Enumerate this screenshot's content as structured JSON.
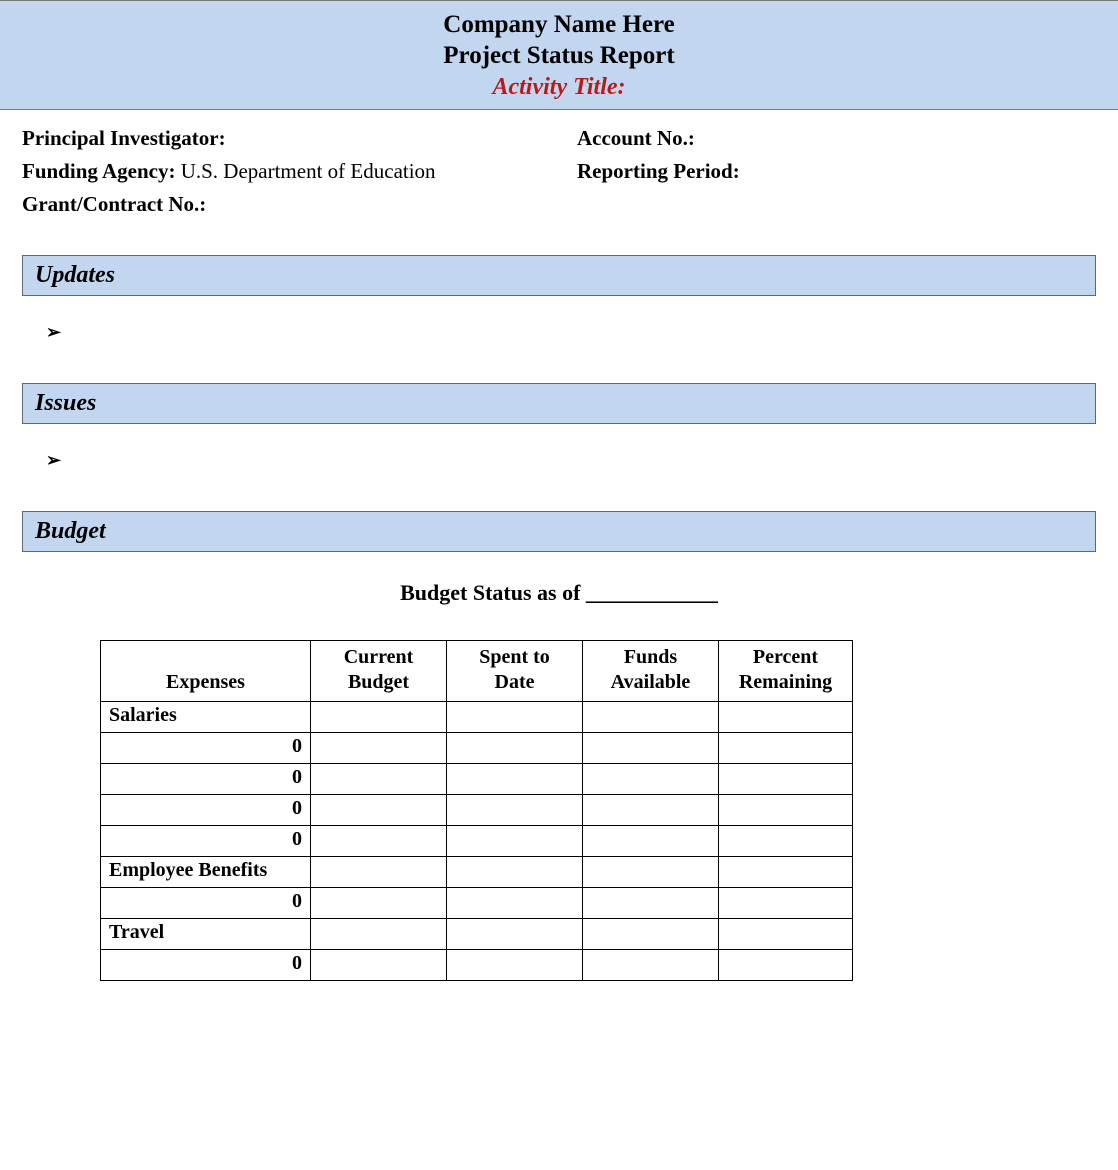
{
  "header": {
    "company": "Company Name Here",
    "report_title": "Project Status Report",
    "activity_label": "Activity Title:"
  },
  "info": {
    "principal_investigator_label": "Principal Investigator:",
    "principal_investigator_value": "",
    "account_no_label": "Account No.:",
    "account_no_value": "",
    "funding_agency_label": "Funding Agency:",
    "funding_agency_value": " U.S. Department of Education",
    "reporting_period_label": "Reporting Period:",
    "reporting_period_value": "",
    "grant_contract_label": "Grant/Contract No.:",
    "grant_contract_value": ""
  },
  "sections": {
    "updates_title": "Updates",
    "issues_title": "Issues",
    "budget_title": "Budget",
    "bullet_glyph": "➢"
  },
  "budget_status": {
    "label": "Budget Status as of ____________"
  },
  "budget_table": {
    "headers": {
      "expenses": "Expenses",
      "current_budget": "Current\nBudget",
      "spent_to_date": "Spent to\nDate",
      "funds_available": "Funds\nAvailable",
      "percent_remaining": "Percent\nRemaining"
    },
    "rows": [
      {
        "label": "Salaries",
        "align": "left",
        "cb": "",
        "sd": "",
        "fa": "",
        "pr": ""
      },
      {
        "label": "0",
        "align": "right",
        "cb": "",
        "sd": "",
        "fa": "",
        "pr": ""
      },
      {
        "label": "0",
        "align": "right",
        "cb": "",
        "sd": "",
        "fa": "",
        "pr": ""
      },
      {
        "label": "0",
        "align": "right",
        "cb": "",
        "sd": "",
        "fa": "",
        "pr": ""
      },
      {
        "label": "0",
        "align": "right",
        "cb": "",
        "sd": "",
        "fa": "",
        "pr": ""
      },
      {
        "label": "Employee Benefits",
        "align": "left",
        "cb": "",
        "sd": "",
        "fa": "",
        "pr": ""
      },
      {
        "label": "0",
        "align": "right",
        "cb": "",
        "sd": "",
        "fa": "",
        "pr": ""
      },
      {
        "label": "Travel",
        "align": "left",
        "cb": "",
        "sd": "",
        "fa": "",
        "pr": ""
      },
      {
        "label": "0",
        "align": "right",
        "cb": "",
        "sd": "",
        "fa": "",
        "pr": ""
      }
    ]
  }
}
